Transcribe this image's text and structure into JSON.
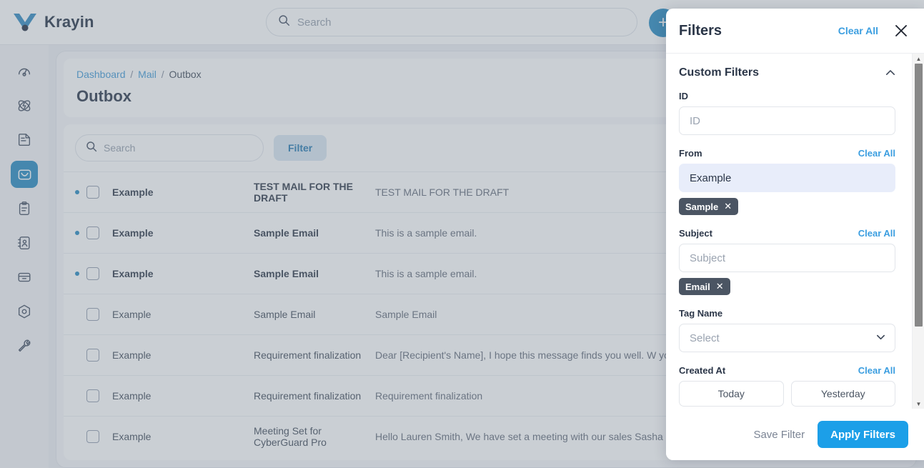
{
  "header": {
    "brand": "Krayin",
    "search_placeholder": "Search",
    "add_button_label": "+"
  },
  "sidebar": {
    "items": [
      {
        "name": "dashboard",
        "icon": "speedometer-icon",
        "active": false
      },
      {
        "name": "leads",
        "icon": "atom-icon",
        "active": false
      },
      {
        "name": "quotes",
        "icon": "document-icon",
        "active": false
      },
      {
        "name": "mail",
        "icon": "mail-icon",
        "active": true
      },
      {
        "name": "activities",
        "icon": "clipboard-icon",
        "active": false
      },
      {
        "name": "contacts",
        "icon": "address-book-icon",
        "active": false
      },
      {
        "name": "products",
        "icon": "box-icon",
        "active": false
      },
      {
        "name": "settings",
        "icon": "hexagon-gear-icon",
        "active": false
      },
      {
        "name": "configuration",
        "icon": "wrench-icon",
        "active": false
      }
    ]
  },
  "breadcrumb": {
    "dashboard": "Dashboard",
    "mail": "Mail",
    "current": "Outbox",
    "separator": "/"
  },
  "page": {
    "title": "Outbox"
  },
  "toolbar": {
    "search_placeholder": "Search",
    "filter_label": "Filter"
  },
  "mail_list": {
    "rows": [
      {
        "sender": "Example",
        "subject": "TEST MAIL FOR THE DRAFT",
        "snippet": "TEST MAIL FOR THE DRAFT",
        "unread": true
      },
      {
        "sender": "Example",
        "subject": "Sample Email",
        "snippet": "This is a sample email.",
        "unread": true
      },
      {
        "sender": "Example",
        "subject": "Sample Email",
        "snippet": "This is a sample email.",
        "unread": true
      },
      {
        "sender": "Example",
        "subject": "Sample Email",
        "snippet": "Sample Email",
        "unread": false
      },
      {
        "sender": "Example",
        "subject": "Requirement finalization",
        "snippet": "Dear [Recipient's Name], I hope this message finds you well. W you...",
        "unread": false
      },
      {
        "sender": "Example",
        "subject": "Requirement finalization",
        "snippet": "Requirement finalization",
        "unread": false
      },
      {
        "sender": "Example",
        "subject": "Meeting Set for CyberGuard Pro",
        "snippet": "Hello Lauren Smith, We have set a meeting with our sales Sasha Calle....",
        "unread": false
      }
    ]
  },
  "filters_panel": {
    "title": "Filters",
    "clear_all": "Clear All",
    "close_icon": "close-icon",
    "section": {
      "title": "Custom Filters",
      "collapse_icon": "chevron-up-icon"
    },
    "fields": {
      "id": {
        "label": "ID",
        "placeholder": "ID",
        "value": ""
      },
      "from": {
        "label": "From",
        "clear_all": "Clear All",
        "value": "Example",
        "chips": [
          {
            "label": "Sample",
            "remove": "✕"
          }
        ]
      },
      "subject": {
        "label": "Subject",
        "clear_all": "Clear All",
        "placeholder": "Subject",
        "value": "",
        "chips": [
          {
            "label": "Email",
            "remove": "✕"
          }
        ]
      },
      "tag_name": {
        "label": "Tag Name",
        "selected": "Select"
      },
      "created_at": {
        "label": "Created At",
        "clear_all": "Clear All",
        "options": [
          "Today",
          "Yesterday"
        ]
      }
    },
    "footer": {
      "save_filter": "Save Filter",
      "apply_filters": "Apply Filters"
    }
  },
  "colors": {
    "accent_blue": "#1c9fe8",
    "link_blue": "#3b9ee0",
    "sidebar_active": "#2f8fc4",
    "chip_bg": "#4b5563",
    "filled_input_bg": "#e8edfa"
  }
}
